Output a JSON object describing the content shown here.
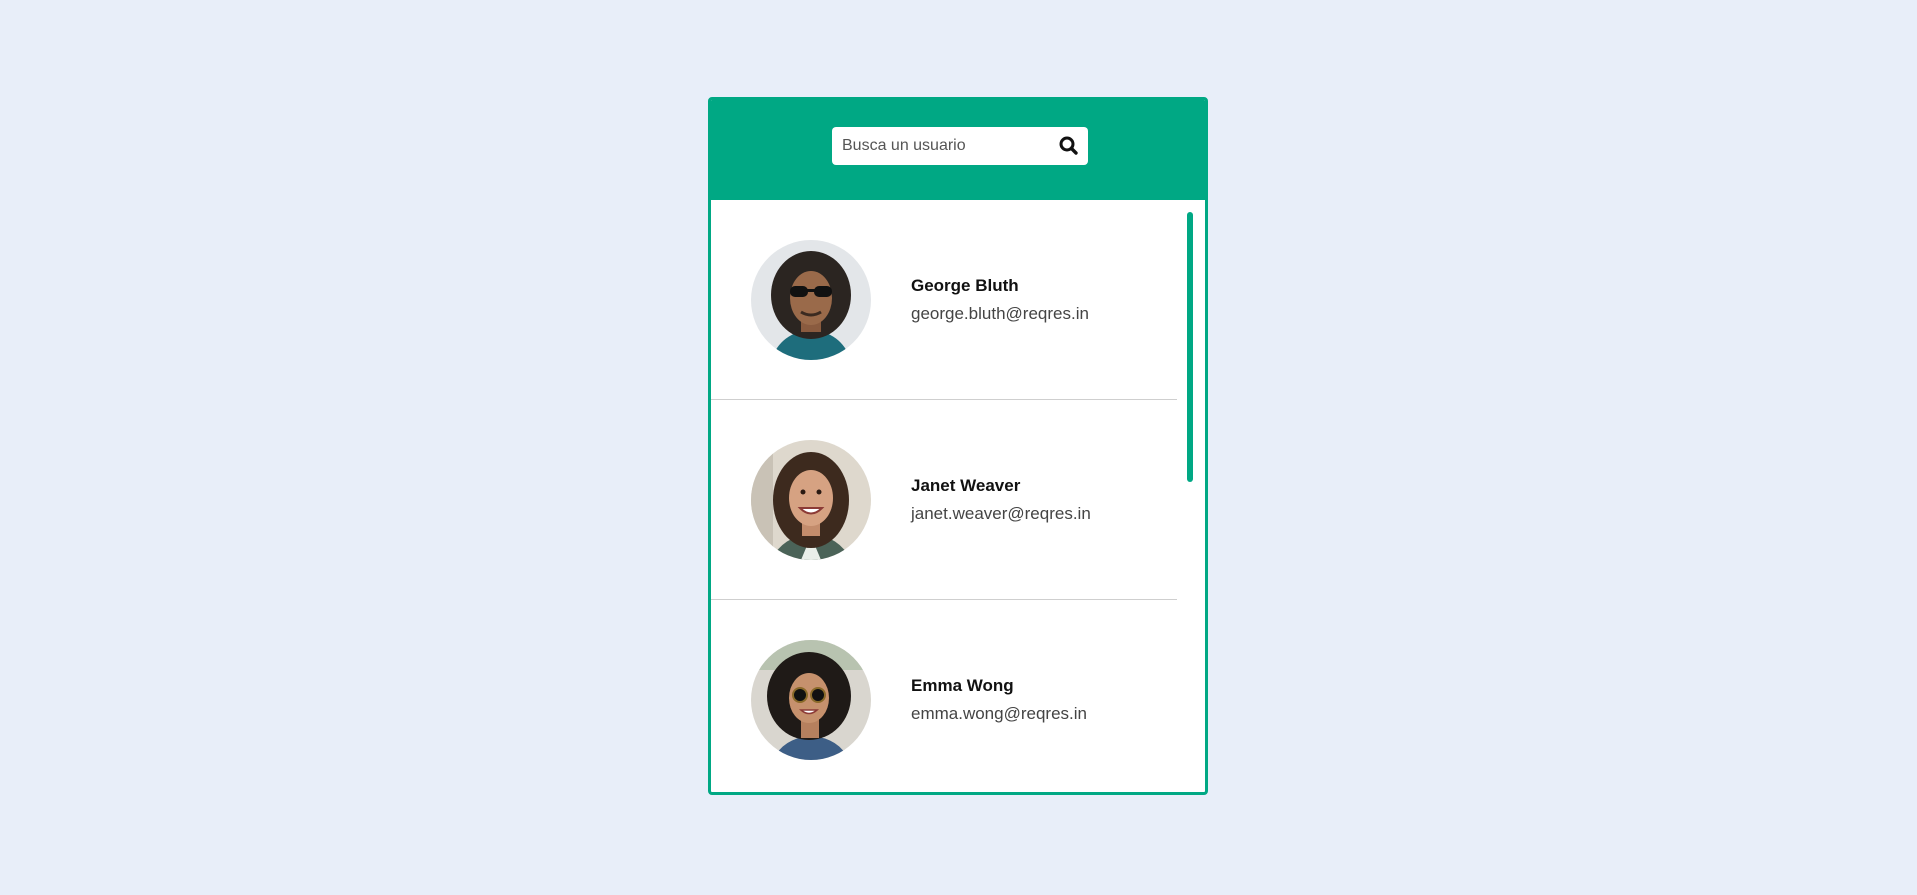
{
  "search": {
    "placeholder": "Busca un usuario",
    "value": "",
    "icon": "search-icon"
  },
  "users": [
    {
      "name": "George Bluth",
      "email": "george.bluth@reqres.in",
      "avatar_icon": "avatar-george"
    },
    {
      "name": "Janet Weaver",
      "email": "janet.weaver@reqres.in",
      "avatar_icon": "avatar-janet"
    },
    {
      "name": "Emma Wong",
      "email": "emma.wong@reqres.in",
      "avatar_icon": "avatar-emma"
    }
  ],
  "colors": {
    "accent": "#00a884",
    "page_background": "#e8eef9",
    "card_background": "#ffffff",
    "divider": "#cfcfcf"
  }
}
